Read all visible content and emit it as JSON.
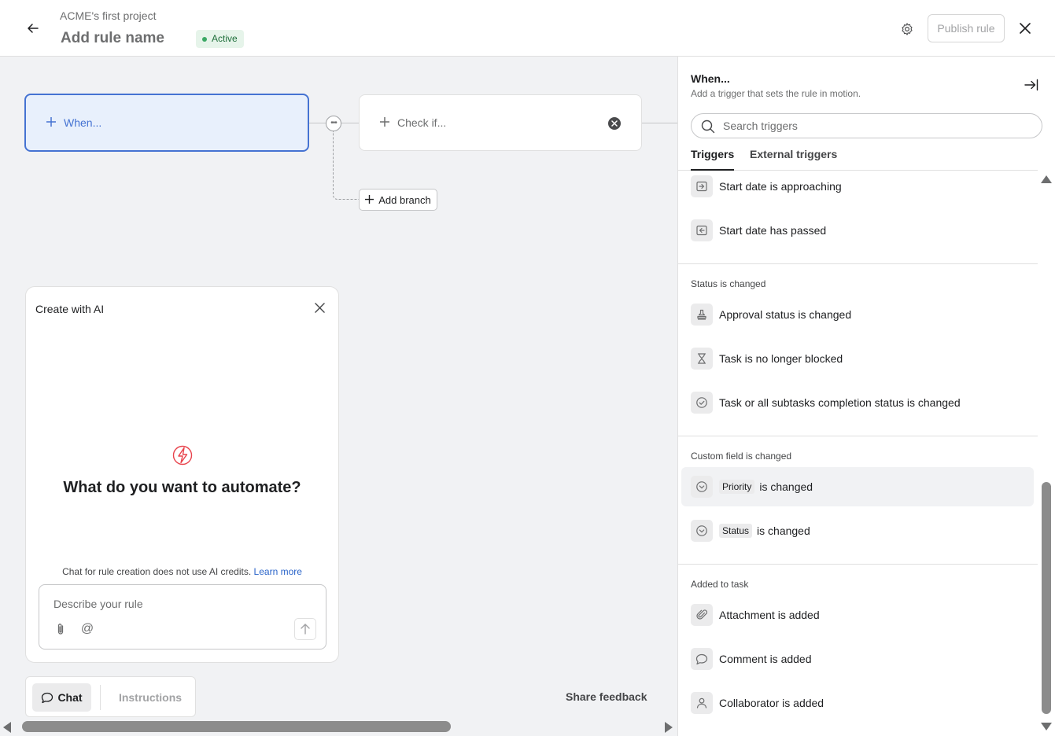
{
  "header": {
    "project_name": "ACME's first project",
    "rule_name": "Add rule name",
    "status": "Active",
    "publish_label": "Publish rule"
  },
  "canvas": {
    "when_label": "When...",
    "check_label": "Check if...",
    "add_branch_label": "Add branch",
    "share_feedback": "Share feedback"
  },
  "ai_panel": {
    "title": "Create with AI",
    "question": "What do you want to automate?",
    "note": "Chat for rule creation does not use AI credits.",
    "learn_more": "Learn more",
    "input_placeholder": "Describe your rule"
  },
  "bottom_tabs": {
    "chat": "Chat",
    "instructions": "Instructions"
  },
  "side_panel": {
    "title": "When...",
    "subtitle": "Add a trigger that sets the rule in motion.",
    "search_placeholder": "Search triggers",
    "tabs": [
      "Triggers",
      "External triggers"
    ],
    "items": [
      {
        "label": "Start date is approaching",
        "icon": "calendar-forward-icon"
      },
      {
        "label": "Start date has passed",
        "icon": "calendar-back-icon"
      }
    ],
    "sections": [
      {
        "heading": "Status is changed",
        "items": [
          {
            "label": "Approval status is changed",
            "icon": "stamp-icon"
          },
          {
            "label": "Task is no longer blocked",
            "icon": "hourglass-icon"
          },
          {
            "label": "Task or all subtasks completion status is changed",
            "icon": "check-circle-icon"
          }
        ]
      },
      {
        "heading": "Custom field is changed",
        "items": [
          {
            "chip": "Priority",
            "label": "is changed",
            "icon": "dropdown-circle-icon"
          },
          {
            "chip": "Status",
            "label": "is changed",
            "icon": "dropdown-circle-icon"
          }
        ]
      },
      {
        "heading": "Added to task",
        "items": [
          {
            "label": "Attachment is added",
            "icon": "paperclip-icon"
          },
          {
            "label": "Comment is added",
            "icon": "comment-icon"
          },
          {
            "label": "Collaborator is added",
            "icon": "person-icon"
          }
        ]
      }
    ]
  },
  "colors": {
    "accent": "#4573d2",
    "active_badge": "#e6f4ea",
    "bolt": "#e8434c"
  }
}
